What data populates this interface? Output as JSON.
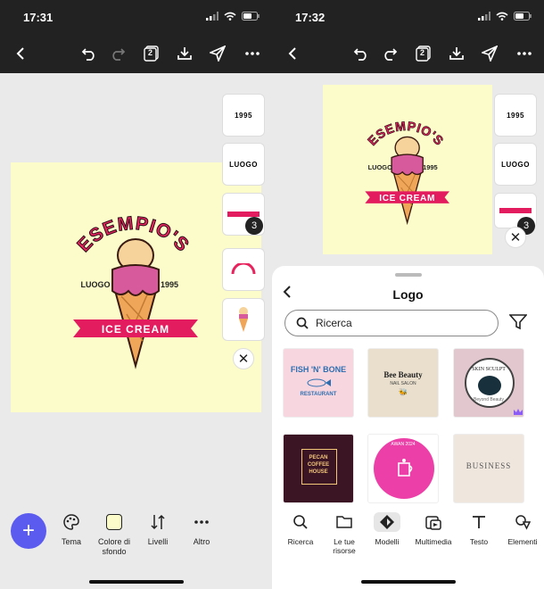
{
  "left": {
    "status": {
      "time": "17:31"
    },
    "toolbar": {
      "page_count": "2"
    },
    "logo": {
      "brand": "ESEMPIO'S",
      "left_text": "LUOGO",
      "right_text": "1995",
      "banner": "ICE CREAM"
    },
    "thumbs": [
      "1995",
      "LUOGO"
    ],
    "badge": "3",
    "tools": [
      {
        "icon": "palette-icon",
        "label": "Tema"
      },
      {
        "icon": "color-swatch-icon",
        "label": "Colore di sfondo"
      },
      {
        "icon": "layers-icon",
        "label": "Livelli"
      },
      {
        "icon": "more-icon",
        "label": "Altro"
      }
    ],
    "fab": "+"
  },
  "right": {
    "status": {
      "time": "17:32"
    },
    "toolbar": {
      "page_count": "2"
    },
    "logo": {
      "brand": "ESEMPIO'S",
      "left_text": "LUOGO",
      "right_text": "1995",
      "banner": "ICE CREAM"
    },
    "thumbs": [
      "1995",
      "LUOGO"
    ],
    "badge": "3",
    "panel": {
      "title": "Logo",
      "search_placeholder": "Ricerca",
      "templates": [
        {
          "lines": [
            "FISH 'N' BONE",
            "RESTAURANT"
          ],
          "bg": "#f7d6df"
        },
        {
          "lines": [
            "Bee Beauty",
            "NAIL SALON"
          ],
          "bg": "#e9dfcc"
        },
        {
          "lines": [
            "SKIN SCULPT",
            "Beyond Beauty"
          ],
          "bg": "#e2c7cf"
        },
        {
          "lines": [
            "PECAN",
            "COFFEE",
            "HOUSE"
          ],
          "bg": "#3c1525"
        },
        {
          "lines": [
            "AWAN 2024"
          ],
          "bg": "#ffffff"
        },
        {
          "lines": [
            "BUSINESS"
          ],
          "bg": "#efe6de"
        }
      ],
      "tabs": [
        {
          "icon": "search-icon",
          "label": "Ricerca"
        },
        {
          "icon": "folder-icon",
          "label": "Le tue risorse"
        },
        {
          "icon": "templates-icon",
          "label": "Modelli"
        },
        {
          "icon": "media-icon",
          "label": "Multimedia"
        },
        {
          "icon": "text-icon",
          "label": "Testo"
        },
        {
          "icon": "elements-icon",
          "label": "Elementi"
        }
      ]
    }
  }
}
